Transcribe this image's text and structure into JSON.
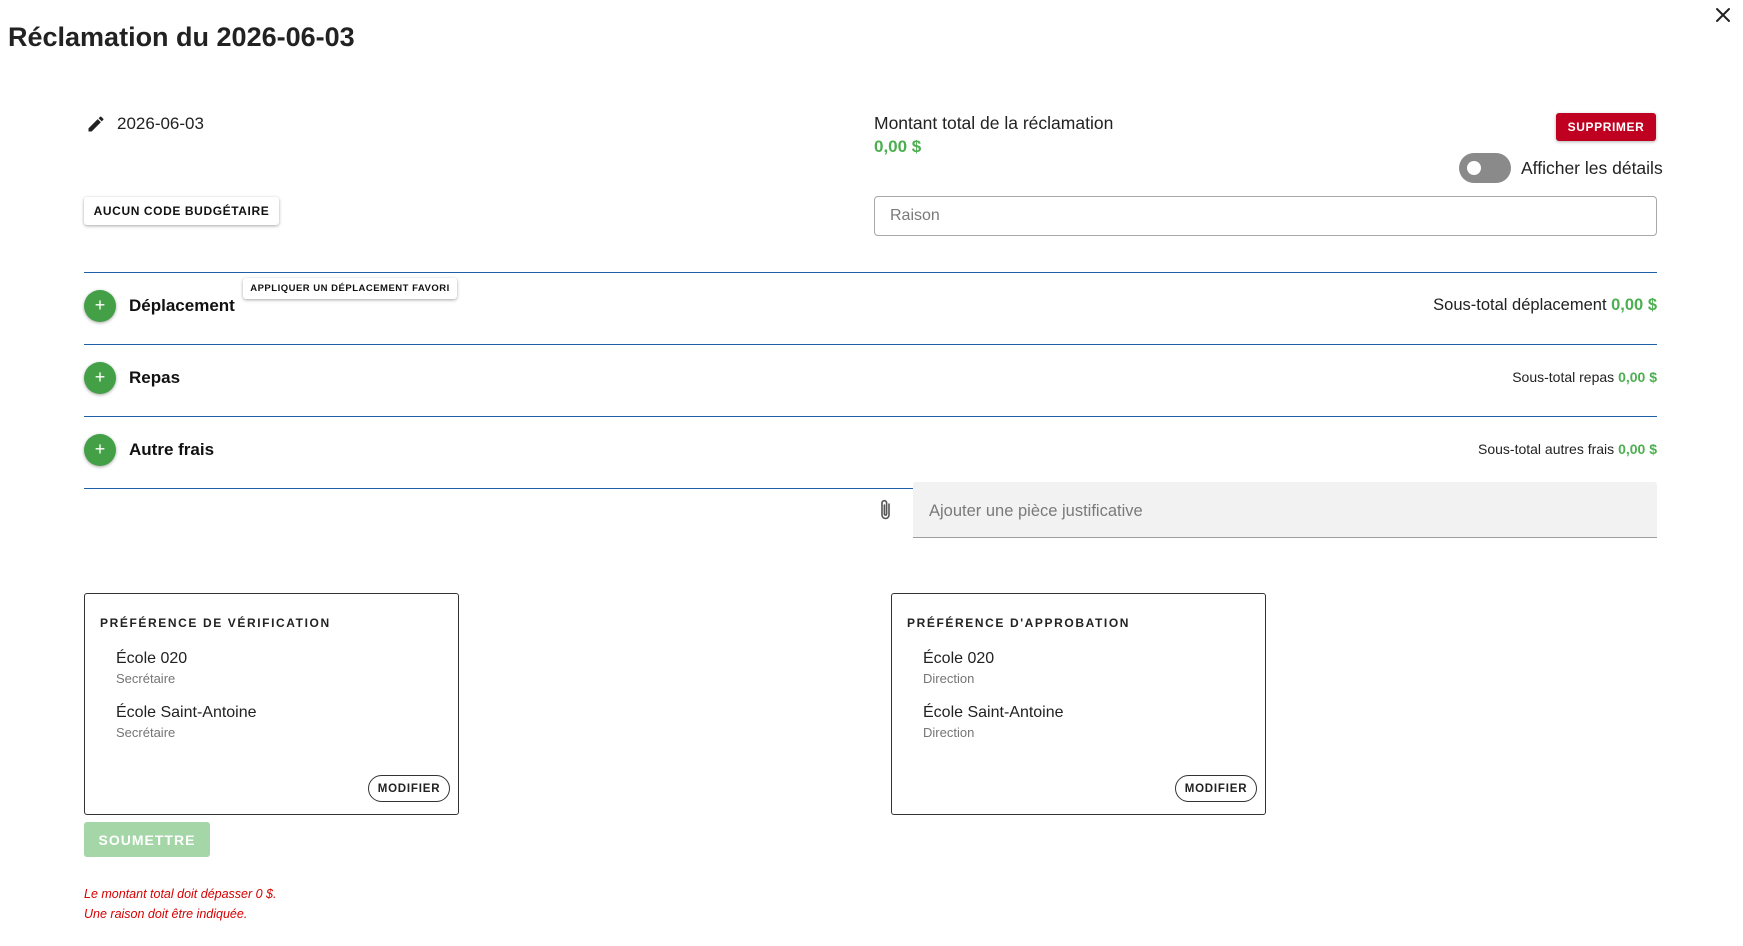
{
  "header": {
    "title": "Réclamation du 2026-06-03"
  },
  "claim": {
    "date": "2026-06-03",
    "budget_code_label": "AUCUN CODE BUDGÉTAIRE",
    "total_label": "Montant total de la réclamation",
    "total_amount": "0,00 $",
    "delete_label": "SUPPRIMER",
    "details_toggle_label": "Afficher les détails",
    "details_toggle_on": false,
    "reason_placeholder": "Raison",
    "reason_value": ""
  },
  "sections": {
    "travel": {
      "title": "Déplacement",
      "favorite_button": "APPLIQUER UN DÉPLACEMENT FAVORI",
      "subtotal_label": "Sous-total déplacement",
      "subtotal_amount": "0,00 $"
    },
    "meals": {
      "title": "Repas",
      "subtotal_label": "Sous-total repas",
      "subtotal_amount": "0,00 $"
    },
    "other": {
      "title": "Autre frais",
      "subtotal_label": "Sous-total autres frais",
      "subtotal_amount": "0,00 $"
    },
    "add_symbol": "+"
  },
  "attachment": {
    "placeholder": "Ajouter une pièce justificative"
  },
  "verification": {
    "title": "PRÉFÉRENCE DE VÉRIFICATION",
    "entries": [
      {
        "name": "École 020",
        "role": "Secrétaire"
      },
      {
        "name": "École Saint-Antoine",
        "role": "Secrétaire"
      }
    ],
    "modify_label": "MODIFIER"
  },
  "approval": {
    "title": "PRÉFÉRENCE D'APPROBATION",
    "entries": [
      {
        "name": "École 020",
        "role": "Direction"
      },
      {
        "name": "École Saint-Antoine",
        "role": "Direction"
      }
    ],
    "modify_label": "MODIFIER"
  },
  "submit": {
    "label": "SOUMETTRE",
    "enabled": false
  },
  "errors": [
    "Le montant total doit dépasser 0 $.",
    "Une raison doit être indiquée."
  ],
  "colors": {
    "amount_green": "#4caf50",
    "add_green": "#43a047",
    "delete_red": "#c00020",
    "section_rule_blue": "#1f5fa8",
    "submit_disabled_green": "#a5d6a7",
    "error_red": "#d50000"
  },
  "icons": {
    "close": "close-icon",
    "edit": "pencil-icon",
    "attach": "paperclip-icon"
  }
}
